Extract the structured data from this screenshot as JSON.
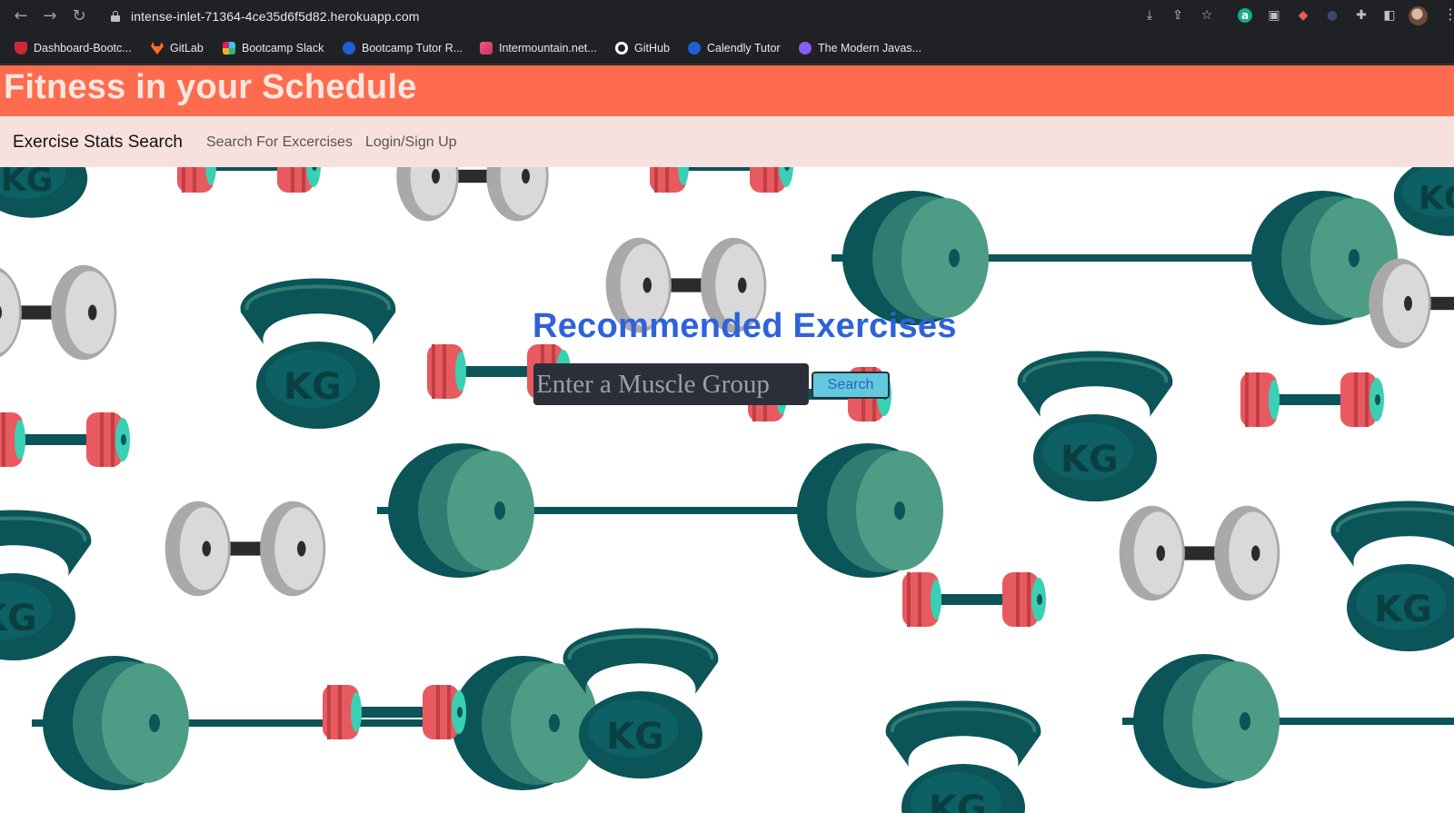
{
  "browser": {
    "url": "intense-inlet-71364-4ce35d6f5d82.herokuapp.com",
    "bookmarks": [
      {
        "label": "Dashboard-Bootc...",
        "icon": "utah-u-icon"
      },
      {
        "label": "GitLab",
        "icon": "gitlab-icon"
      },
      {
        "label": "Bootcamp Slack",
        "icon": "slack-icon"
      },
      {
        "label": "Bootcamp Tutor R...",
        "icon": "calendly-icon"
      },
      {
        "label": "Intermountain.net...",
        "icon": "intermountain-icon"
      },
      {
        "label": "GitHub",
        "icon": "github-icon"
      },
      {
        "label": "Calendly Tutor",
        "icon": "calendly-icon"
      },
      {
        "label": "The Modern Javas...",
        "icon": "js-info-icon"
      }
    ]
  },
  "site": {
    "title": "Fitness in your Schedule"
  },
  "navbar": {
    "brand": "Exercise Stats Search",
    "links": [
      "Search For Excercises",
      "Login/Sign Up"
    ]
  },
  "main": {
    "heading": "Recommended Exercises",
    "search_placeholder": "Enter a Muscle Group",
    "search_button": "Search"
  },
  "colors": {
    "header_bg": "#ff6b4e",
    "navbar_bg": "#f7e1df",
    "heading": "#2f62d8",
    "search_button_bg": "#62c8dc",
    "weight_dark": "#0b5458",
    "weight_plate_face": "#4d9c86",
    "dumbbell_red": "#e85a5f",
    "dumbbell_teal": "#39d0b4"
  }
}
